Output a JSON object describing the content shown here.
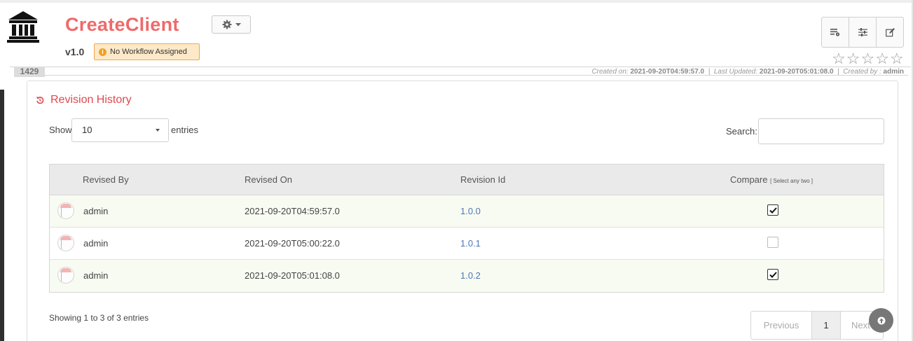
{
  "header": {
    "title": "CreateClient",
    "version": "v1.0",
    "workflow_badge": "No Workflow Assigned",
    "workflow_badge_icon": "info-icon",
    "record_id": "1429",
    "meta": {
      "created_on_label": "Created on:",
      "created_on": "2021-09-20T04:59:57.0",
      "separator1": "|",
      "updated_label": "Last Updated:",
      "updated": "2021-09-20T05:01:08.0",
      "separator2": "|",
      "created_by_label": "Created by :",
      "created_by": "admin"
    },
    "rating": {
      "stars_total": 5,
      "stars_filled": 0
    },
    "toolbar_icons": [
      "list-settings-icon",
      "sliders-icon",
      "edit-icon"
    ],
    "gear_icon": "gear-icon"
  },
  "panel": {
    "title": "Revision History",
    "title_icon": "history-icon",
    "show_label": "Show",
    "page_length": "10",
    "entries_label": "entries",
    "search_label": "Search:",
    "search_value": ""
  },
  "table": {
    "columns": {
      "revised_by": "Revised By",
      "revised_on": "Revised On",
      "revision_id": "Revision Id",
      "compare": "Compare",
      "compare_hint": "[ Select any two ]"
    },
    "rows": [
      {
        "revised_by": "admin",
        "revised_on": "2021-09-20T04:59:57.0",
        "revision_id": "1.0.0",
        "compare": true
      },
      {
        "revised_by": "admin",
        "revised_on": "2021-09-20T05:00:22.0",
        "revision_id": "1.0.1",
        "compare": false
      },
      {
        "revised_by": "admin",
        "revised_on": "2021-09-20T05:01:08.0",
        "revision_id": "1.0.2",
        "compare": true
      }
    ]
  },
  "footer": {
    "info": "Showing 1 to 3 of 3 entries",
    "prev_label": "Previous",
    "page": "1",
    "next_label": "Next",
    "scroll_top_icon": "arrow-up-icon"
  },
  "colors": {
    "title": "#ef6a6a",
    "panel_title": "#e0484e",
    "link": "#4d78b5",
    "badge_bg": "#fde9c8",
    "badge_border": "#f0a64f",
    "row_odd": "#f8fbf2"
  }
}
